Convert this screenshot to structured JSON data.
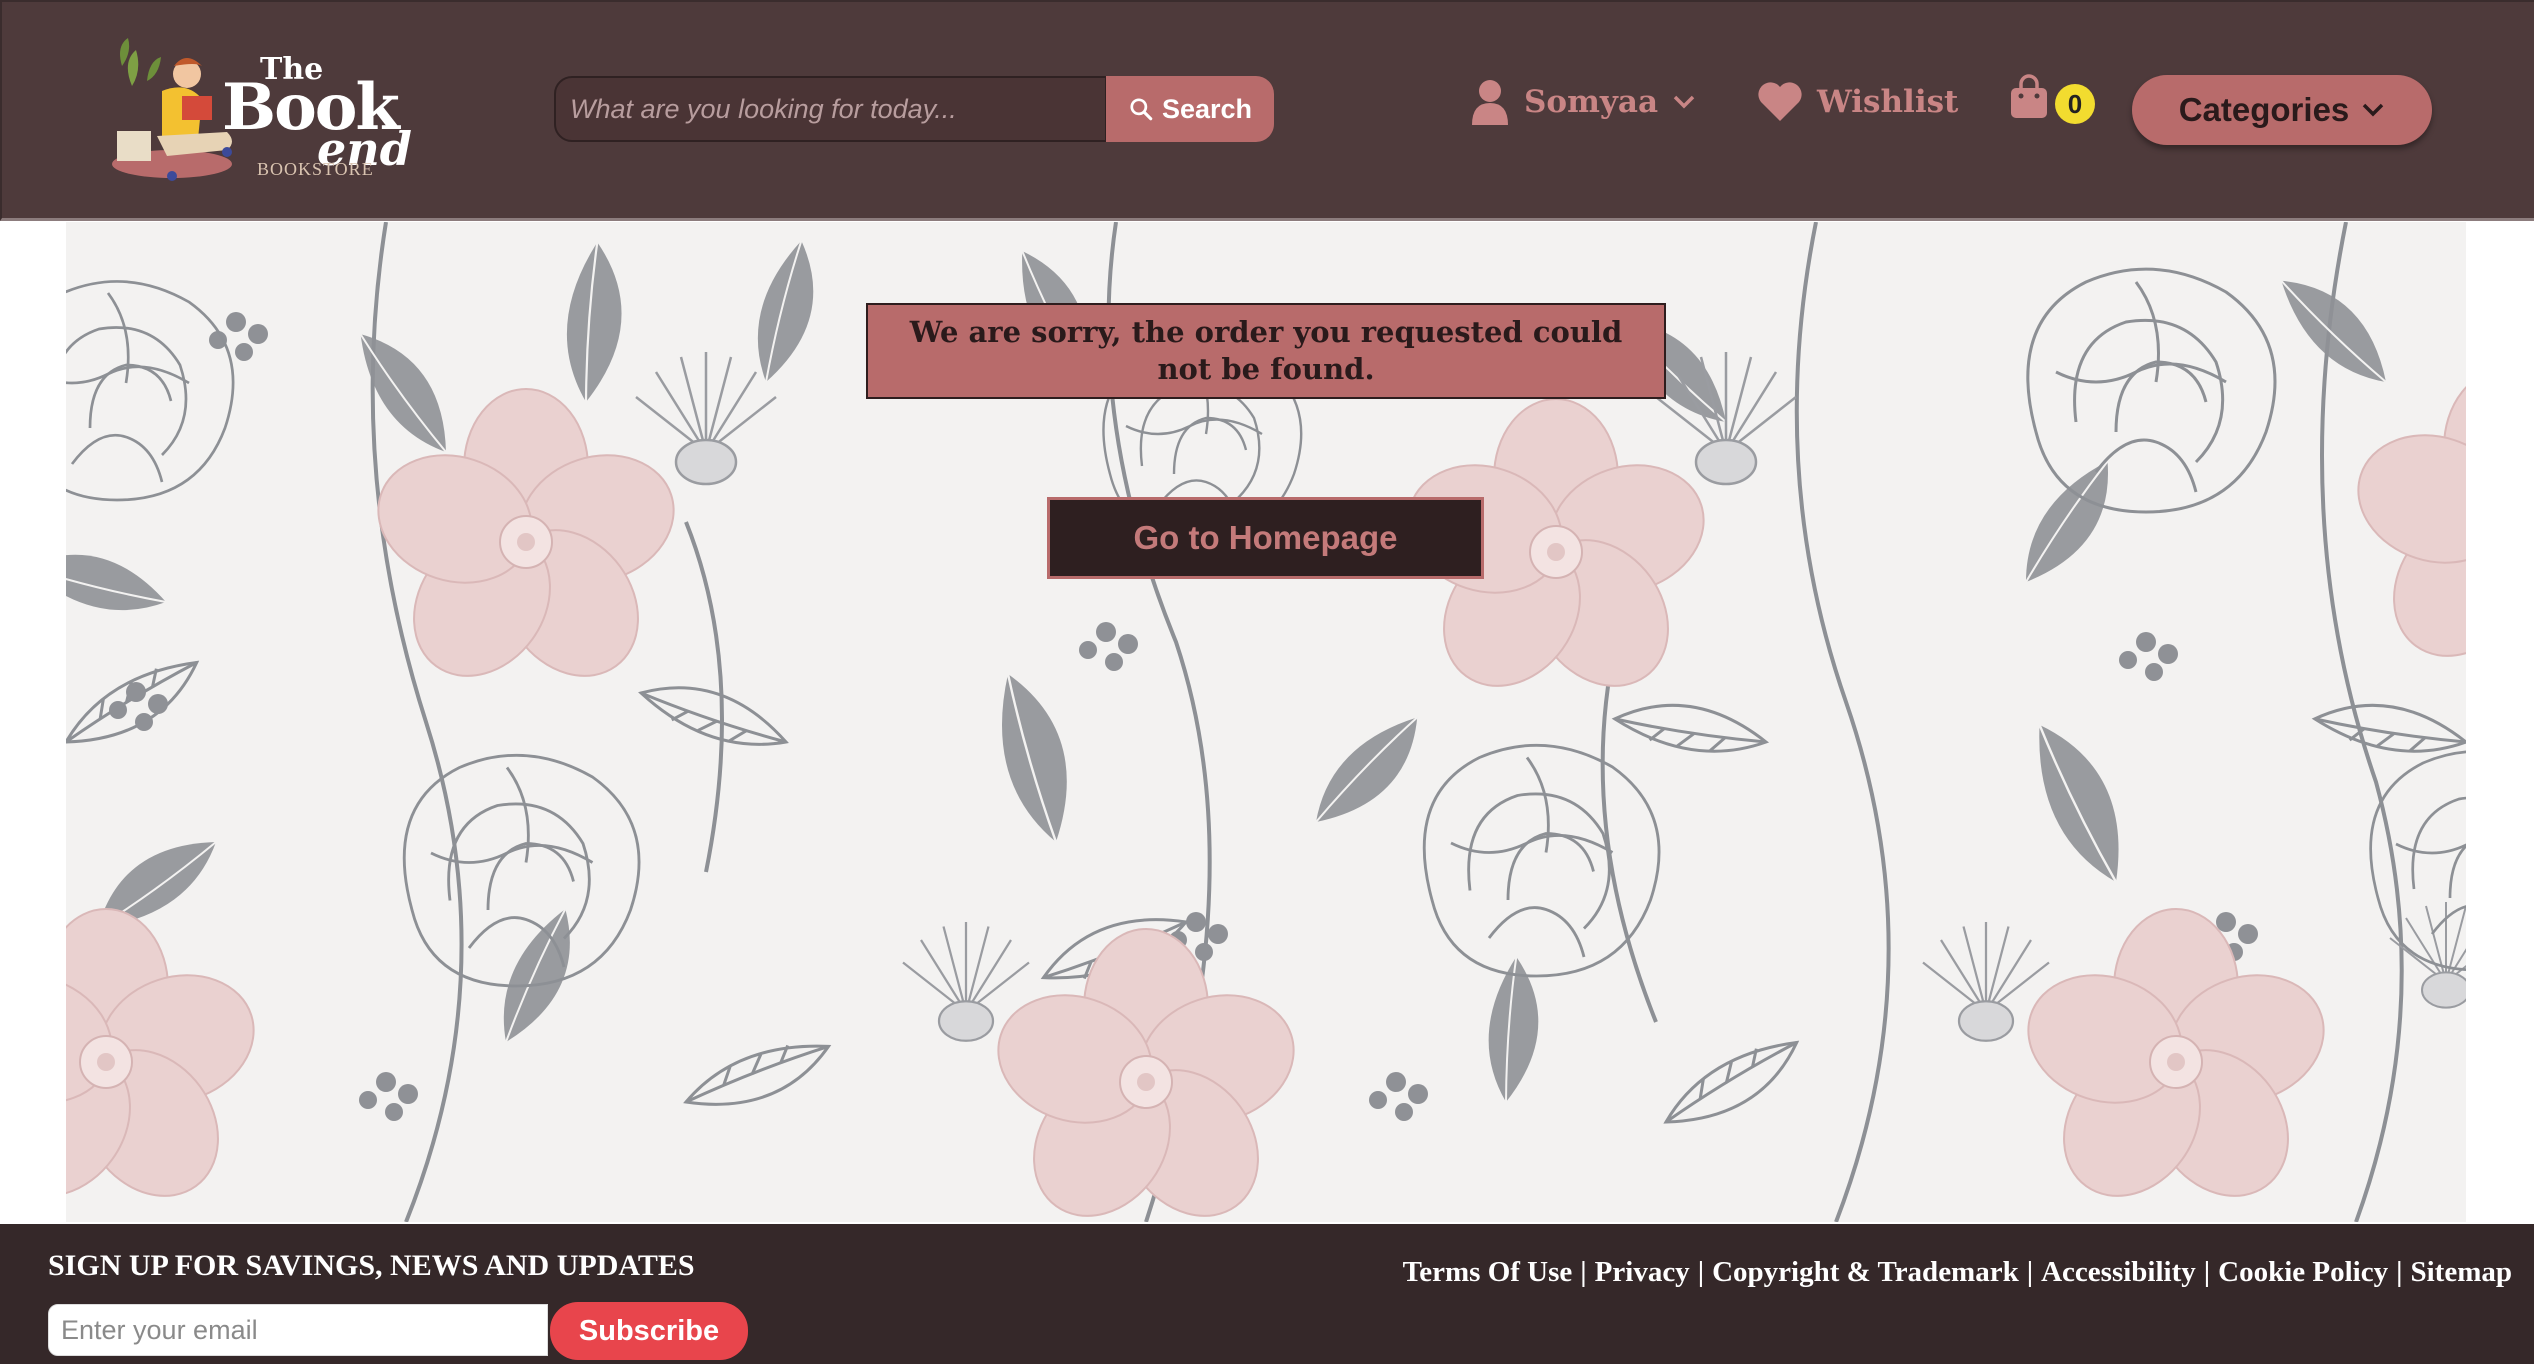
{
  "header": {
    "logo": {
      "the": "The",
      "book": "Book",
      "end": "end",
      "sub": "BOOKSTORE"
    },
    "search": {
      "placeholder": "What are you looking for today...",
      "button_label": "Search"
    },
    "user": {
      "name": "Somyaa"
    },
    "wishlist_label": "Wishlist",
    "cart_count": "0",
    "categories_label": "Categories"
  },
  "main": {
    "alert_text": "We are sorry, the order you requested could not be found.",
    "home_button_label": "Go to Homepage"
  },
  "footer": {
    "signup_title": "SIGN UP FOR SAVINGS, NEWS AND UPDATES",
    "email_placeholder": "Enter your email",
    "subscribe_label": "Subscribe",
    "links": [
      "Terms Of Use",
      "Privacy",
      "Copyright & Trademark",
      "Accessibility",
      "Cookie Policy",
      "Sitemap"
    ]
  },
  "colors": {
    "header_bg": "#4e3a3b",
    "accent": "#b86b6b",
    "footer_bg": "#352829",
    "badge": "#f2dc2f",
    "subscribe": "#e8454c"
  }
}
